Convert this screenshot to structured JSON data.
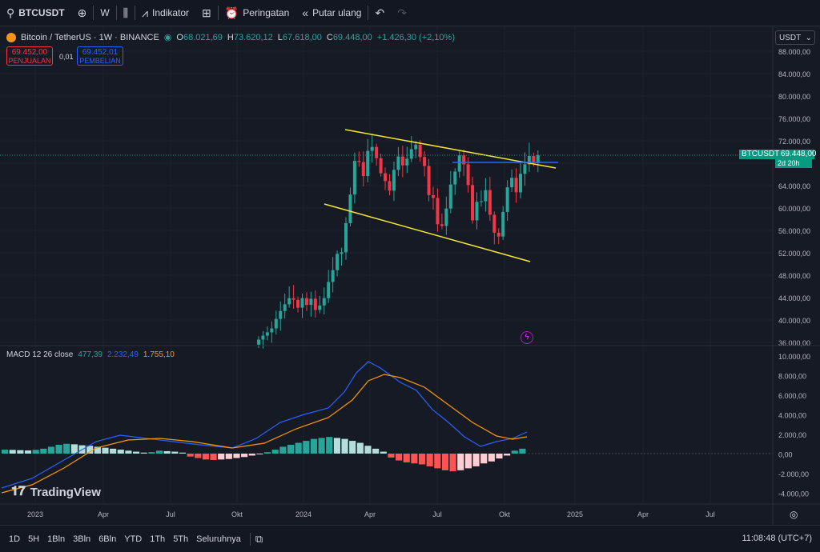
{
  "toolbar": {
    "symbol": "BTCUSDT",
    "interval": "W",
    "indicators_label": "Indikator",
    "alerts_label": "Peringatan",
    "replay_label": "Putar ulang"
  },
  "legend": {
    "title": "Bitcoin / TetherUS · 1W · BINANCE",
    "o_label": "O",
    "o": "68.021,69",
    "h_label": "H",
    "h": "73.620,12",
    "l_label": "L",
    "l": "67.618,00",
    "c_label": "C",
    "c": "69.448,00",
    "change": "+1.426,30 (+2,10%)"
  },
  "trade": {
    "sell_value": "69.452,00",
    "sell_label": "PENJUALAN",
    "spread": "0,01",
    "buy_value": "69.452,01",
    "buy_label": "PEMBELIAN"
  },
  "currency": "USDT",
  "price_tag": {
    "symbol": "BTCUSDT",
    "price": "69.448,00",
    "countdown": "2d 20h"
  },
  "macd": {
    "label": "MACD 12 26 close",
    "hist": "477,39",
    "macd": "2.232,49",
    "signal": "1.755,10"
  },
  "price_axis": [
    "88.000,00",
    "84.000,00",
    "80.000,00",
    "76.000,00",
    "72.000,00",
    "68.000,00",
    "64.000,00",
    "60.000,00",
    "56.000,00",
    "52.000,00",
    "48.000,00",
    "44.000,00",
    "40.000,00",
    "36.000,00"
  ],
  "macd_axis": [
    "10.000,00",
    "8.000,00",
    "6.000,00",
    "4.000,00",
    "2.000,00",
    "0,00",
    "-2.000,00",
    "-4.000,00"
  ],
  "time_axis": [
    "2023",
    "Apr",
    "Jul",
    "Okt",
    "2024",
    "Apr",
    "Jul",
    "Okt",
    "2025",
    "Apr",
    "Jul"
  ],
  "brand": "TradingView",
  "ranges": [
    "1D",
    "5H",
    "1Bln",
    "3Bln",
    "6Bln",
    "YTD",
    "1Th",
    "5Th",
    "Seluruhnya"
  ],
  "clock": "11:08:48 (UTC+7)",
  "colors": {
    "up": "#26a69a",
    "down": "#f23645",
    "trendline": "#f5e63a",
    "macd": "#2962ff",
    "signal": "#ff9800"
  }
}
